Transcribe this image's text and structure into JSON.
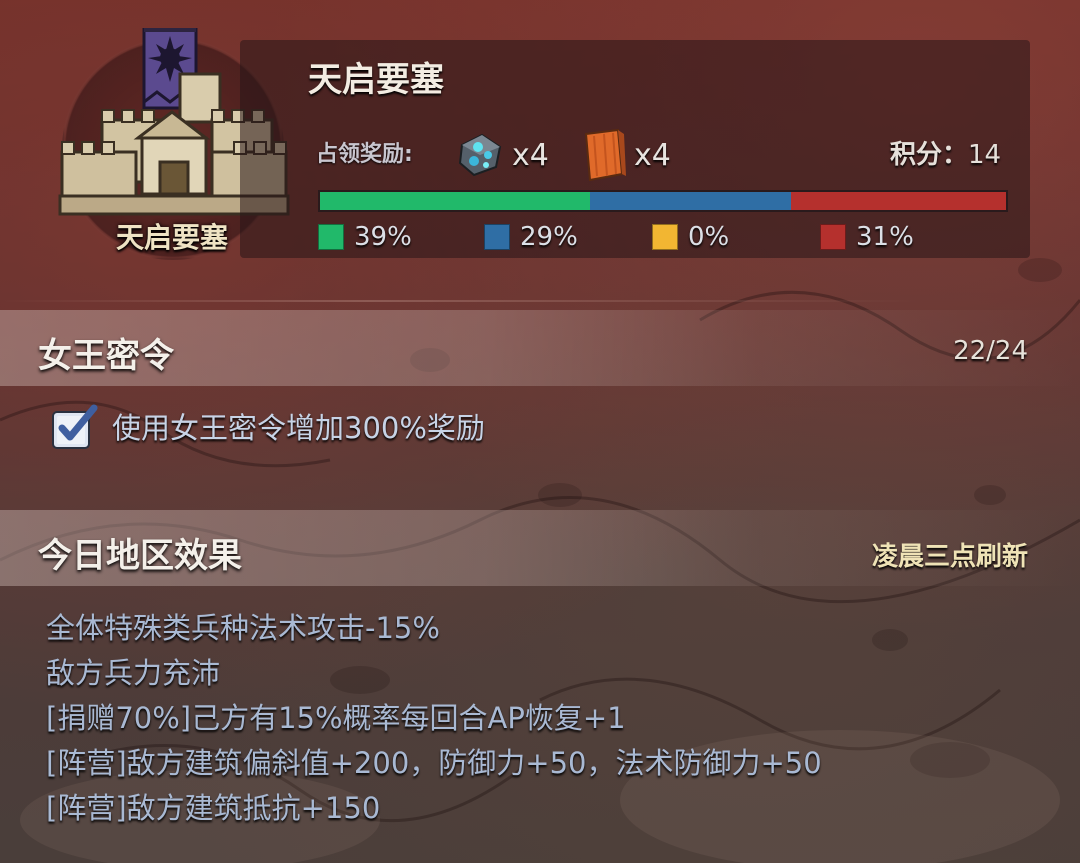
{
  "fortress": {
    "name": "天启要塞",
    "emblem_label": "天启要塞",
    "reward_label": "占领奖励:",
    "rewards": [
      {
        "icon": "crystal-ore-icon",
        "count": "x4"
      },
      {
        "icon": "wood-plank-icon",
        "count": "x4"
      }
    ],
    "score_label": "积分：",
    "score_value": "14",
    "occupation": [
      {
        "color": "#21b96a",
        "percent_value": 39,
        "label": "39%"
      },
      {
        "color": "#2f6ea5",
        "percent_value": 29,
        "label": "29%"
      },
      {
        "color": "#f2b632",
        "percent_value": 0,
        "label": "0%"
      },
      {
        "color": "#b5302d",
        "percent_value": 31,
        "label": "31%"
      }
    ]
  },
  "queen_order": {
    "title": "女王密令",
    "count": "22/24",
    "checkbox_label": "使用女王密令增加300%奖励",
    "checked": true
  },
  "regional_effects": {
    "title": "今日地区效果",
    "refresh_note": "凌晨三点刷新",
    "effects": [
      "全体特殊类兵种法术攻击-15%",
      "敌方兵力充沛",
      "[捐赠70%]己方有15%概率每回合AP恢复+1",
      "[阵营]敌方建筑偏斜值+200，防御力+50，法术防御力+50",
      "[阵营]敌方建筑抵抗+150"
    ]
  }
}
